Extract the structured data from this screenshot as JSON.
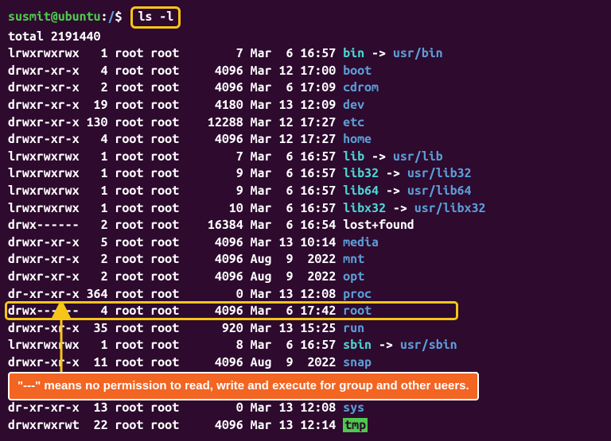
{
  "prompt": {
    "user_host": "susmit@ubuntu",
    "colon": ":",
    "path": "/",
    "dollar": "$",
    "command": "ls -l"
  },
  "total": "total 2191440",
  "rows": [
    {
      "perms": "lrwxrwxrwx",
      "links": "1",
      "owner": "root",
      "group": "root",
      "size": "7",
      "mon": "Mar",
      "day": "6",
      "time": "16:57",
      "name": "bin",
      "type": "link",
      "target": "usr/bin"
    },
    {
      "perms": "drwxr-xr-x",
      "links": "4",
      "owner": "root",
      "group": "root",
      "size": "4096",
      "mon": "Mar",
      "day": "12",
      "time": "17:00",
      "name": "boot",
      "type": "dir"
    },
    {
      "perms": "drwxr-xr-x",
      "links": "2",
      "owner": "root",
      "group": "root",
      "size": "4096",
      "mon": "Mar",
      "day": "6",
      "time": "17:09",
      "name": "cdrom",
      "type": "dir"
    },
    {
      "perms": "drwxr-xr-x",
      "links": "19",
      "owner": "root",
      "group": "root",
      "size": "4180",
      "mon": "Mar",
      "day": "13",
      "time": "12:09",
      "name": "dev",
      "type": "dir"
    },
    {
      "perms": "drwxr-xr-x",
      "links": "130",
      "owner": "root",
      "group": "root",
      "size": "12288",
      "mon": "Mar",
      "day": "12",
      "time": "17:27",
      "name": "etc",
      "type": "dir"
    },
    {
      "perms": "drwxr-xr-x",
      "links": "4",
      "owner": "root",
      "group": "root",
      "size": "4096",
      "mon": "Mar",
      "day": "12",
      "time": "17:27",
      "name": "home",
      "type": "dir"
    },
    {
      "perms": "lrwxrwxrwx",
      "links": "1",
      "owner": "root",
      "group": "root",
      "size": "7",
      "mon": "Mar",
      "day": "6",
      "time": "16:57",
      "name": "lib",
      "type": "link",
      "target": "usr/lib"
    },
    {
      "perms": "lrwxrwxrwx",
      "links": "1",
      "owner": "root",
      "group": "root",
      "size": "9",
      "mon": "Mar",
      "day": "6",
      "time": "16:57",
      "name": "lib32",
      "type": "link",
      "target": "usr/lib32"
    },
    {
      "perms": "lrwxrwxrwx",
      "links": "1",
      "owner": "root",
      "group": "root",
      "size": "9",
      "mon": "Mar",
      "day": "6",
      "time": "16:57",
      "name": "lib64",
      "type": "link",
      "target": "usr/lib64"
    },
    {
      "perms": "lrwxrwxrwx",
      "links": "1",
      "owner": "root",
      "group": "root",
      "size": "10",
      "mon": "Mar",
      "day": "6",
      "time": "16:57",
      "name": "libx32",
      "type": "link",
      "target": "usr/libx32"
    },
    {
      "perms": "drwx------",
      "links": "2",
      "owner": "root",
      "group": "root",
      "size": "16384",
      "mon": "Mar",
      "day": "6",
      "time": "16:54",
      "name": "lost+found",
      "type": "lost"
    },
    {
      "perms": "drwxr-xr-x",
      "links": "5",
      "owner": "root",
      "group": "root",
      "size": "4096",
      "mon": "Mar",
      "day": "13",
      "time": "10:14",
      "name": "media",
      "type": "dir"
    },
    {
      "perms": "drwxr-xr-x",
      "links": "2",
      "owner": "root",
      "group": "root",
      "size": "4096",
      "mon": "Aug",
      "day": "9",
      "time": "2022",
      "name": "mnt",
      "type": "dir"
    },
    {
      "perms": "drwxr-xr-x",
      "links": "2",
      "owner": "root",
      "group": "root",
      "size": "4096",
      "mon": "Aug",
      "day": "9",
      "time": "2022",
      "name": "opt",
      "type": "dir"
    },
    {
      "perms": "dr-xr-xr-x",
      "links": "364",
      "owner": "root",
      "group": "root",
      "size": "0",
      "mon": "Mar",
      "day": "13",
      "time": "12:08",
      "name": "proc",
      "type": "dir"
    },
    {
      "perms": "drwx------",
      "links": "4",
      "owner": "root",
      "group": "root",
      "size": "4096",
      "mon": "Mar",
      "day": "6",
      "time": "17:42",
      "name": "root",
      "type": "dir",
      "highlight": true
    },
    {
      "perms": "drwxr-xr-x",
      "links": "35",
      "owner": "root",
      "group": "root",
      "size": "920",
      "mon": "Mar",
      "day": "13",
      "time": "15:25",
      "name": "run",
      "type": "dir"
    },
    {
      "perms": "lrwxrwxrwx",
      "links": "1",
      "owner": "root",
      "group": "root",
      "size": "8",
      "mon": "Mar",
      "day": "6",
      "time": "16:57",
      "name": "sbin",
      "type": "link",
      "target": "usr/sbin"
    },
    {
      "perms": "drwxr-xr-x",
      "links": "11",
      "owner": "root",
      "group": "root",
      "size": "4096",
      "mon": "Aug",
      "day": "9",
      "time": "2022",
      "name": "snap",
      "type": "dir"
    },
    {
      "perms": "dr-xr-xr-x",
      "links": "13",
      "owner": "root",
      "group": "root",
      "size": "0",
      "mon": "Mar",
      "day": "13",
      "time": "12:08",
      "name": "sys",
      "type": "dir",
      "gap": true
    },
    {
      "perms": "drwxrwxrwt",
      "links": "22",
      "owner": "root",
      "group": "root",
      "size": "4096",
      "mon": "Mar",
      "day": "13",
      "time": "12:14",
      "name": "tmp",
      "type": "tmp"
    }
  ],
  "annotation": "\"---\" means no permission to read, write and execute for group and other ueers."
}
